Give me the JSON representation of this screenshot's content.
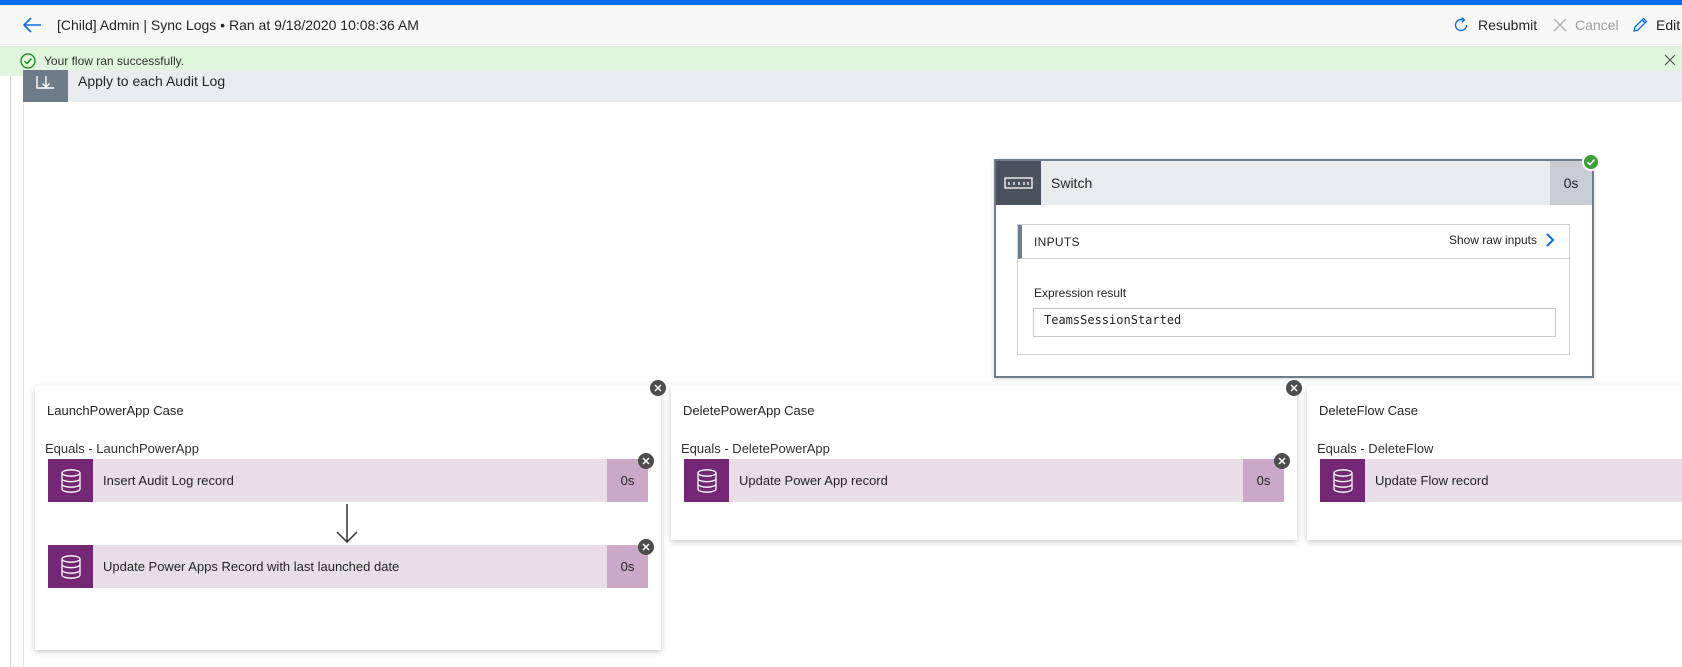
{
  "header": {
    "title": "[Child] Admin | Sync Logs",
    "separator": "•",
    "run_info": "Ran at 9/18/2020 10:08:36 AM",
    "resubmit_label": "Resubmit",
    "cancel_label": "Cancel",
    "edit_label": "Edit"
  },
  "banner": {
    "message": "Your flow ran successfully."
  },
  "foreach": {
    "title": "Apply to each Audit Log"
  },
  "switch": {
    "title": "Switch",
    "duration": "0s",
    "inputs_label": "INPUTS",
    "show_raw_label": "Show raw inputs",
    "expression_label": "Expression result",
    "expression_value": "TeamsSessionStarted"
  },
  "cases": [
    {
      "title": "LaunchPowerApp Case",
      "condition": "Equals - LaunchPowerApp",
      "actions": [
        {
          "label": "Insert Audit Log record",
          "duration": "0s"
        },
        {
          "label": "Update Power Apps Record with last launched date",
          "duration": "0s"
        }
      ]
    },
    {
      "title": "DeletePowerApp Case",
      "condition": "Equals - DeletePowerApp",
      "actions": [
        {
          "label": "Update Power App record",
          "duration": "0s"
        }
      ]
    },
    {
      "title": "DeleteFlow Case",
      "condition": "Equals - DeleteFlow",
      "actions": [
        {
          "label": "Update Flow record"
        }
      ]
    }
  ],
  "colors": {
    "accent": "#0b6ef0",
    "success_bg": "#dff6dd",
    "success_icon": "#107c10",
    "dataverse_purple": "#742774",
    "action_bg": "#e9dde8",
    "switch_header": "#4a5260"
  },
  "icons": {
    "back": "arrow-left-icon",
    "resubmit": "refresh-icon",
    "cancel": "close-icon",
    "edit": "pencil-icon",
    "success": "check-circle-icon",
    "foreach": "loop-icon",
    "switch": "switch-icon",
    "action": "database-icon"
  }
}
